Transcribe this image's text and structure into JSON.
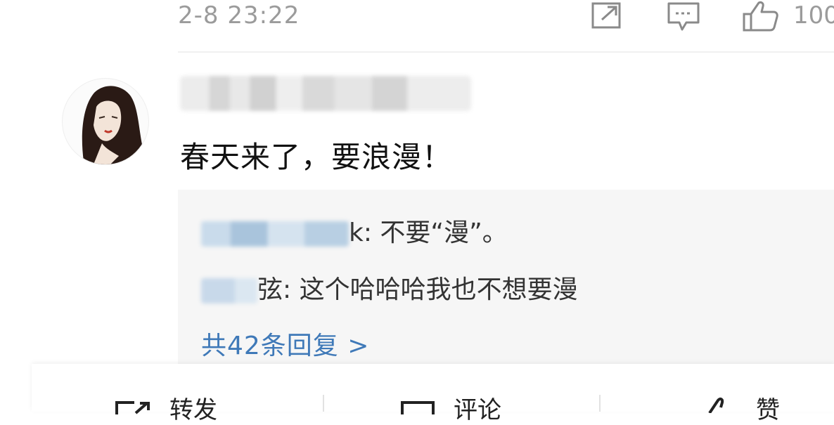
{
  "post_meta": {
    "timestamp": "2-8 23:22",
    "like_count": "100"
  },
  "comment": {
    "text": "春天来了，要浪漫！"
  },
  "replies": [
    {
      "text": "k: 不要“漫”。"
    },
    {
      "text": "弦: 这个哈哈哈我也不想要漫"
    }
  ],
  "more_replies_label": "共42条回复 >",
  "bottom_bar": {
    "repost_label": "转发",
    "comment_label": "评论",
    "like_label": "赞"
  },
  "icons": {
    "share": "share-icon",
    "comment": "comment-icon",
    "like": "thumbs-up-icon"
  },
  "colors": {
    "link_blue": "#3f79b8",
    "reply_bg": "#f6f6f6",
    "meta_gray": "#9b9b9b"
  }
}
